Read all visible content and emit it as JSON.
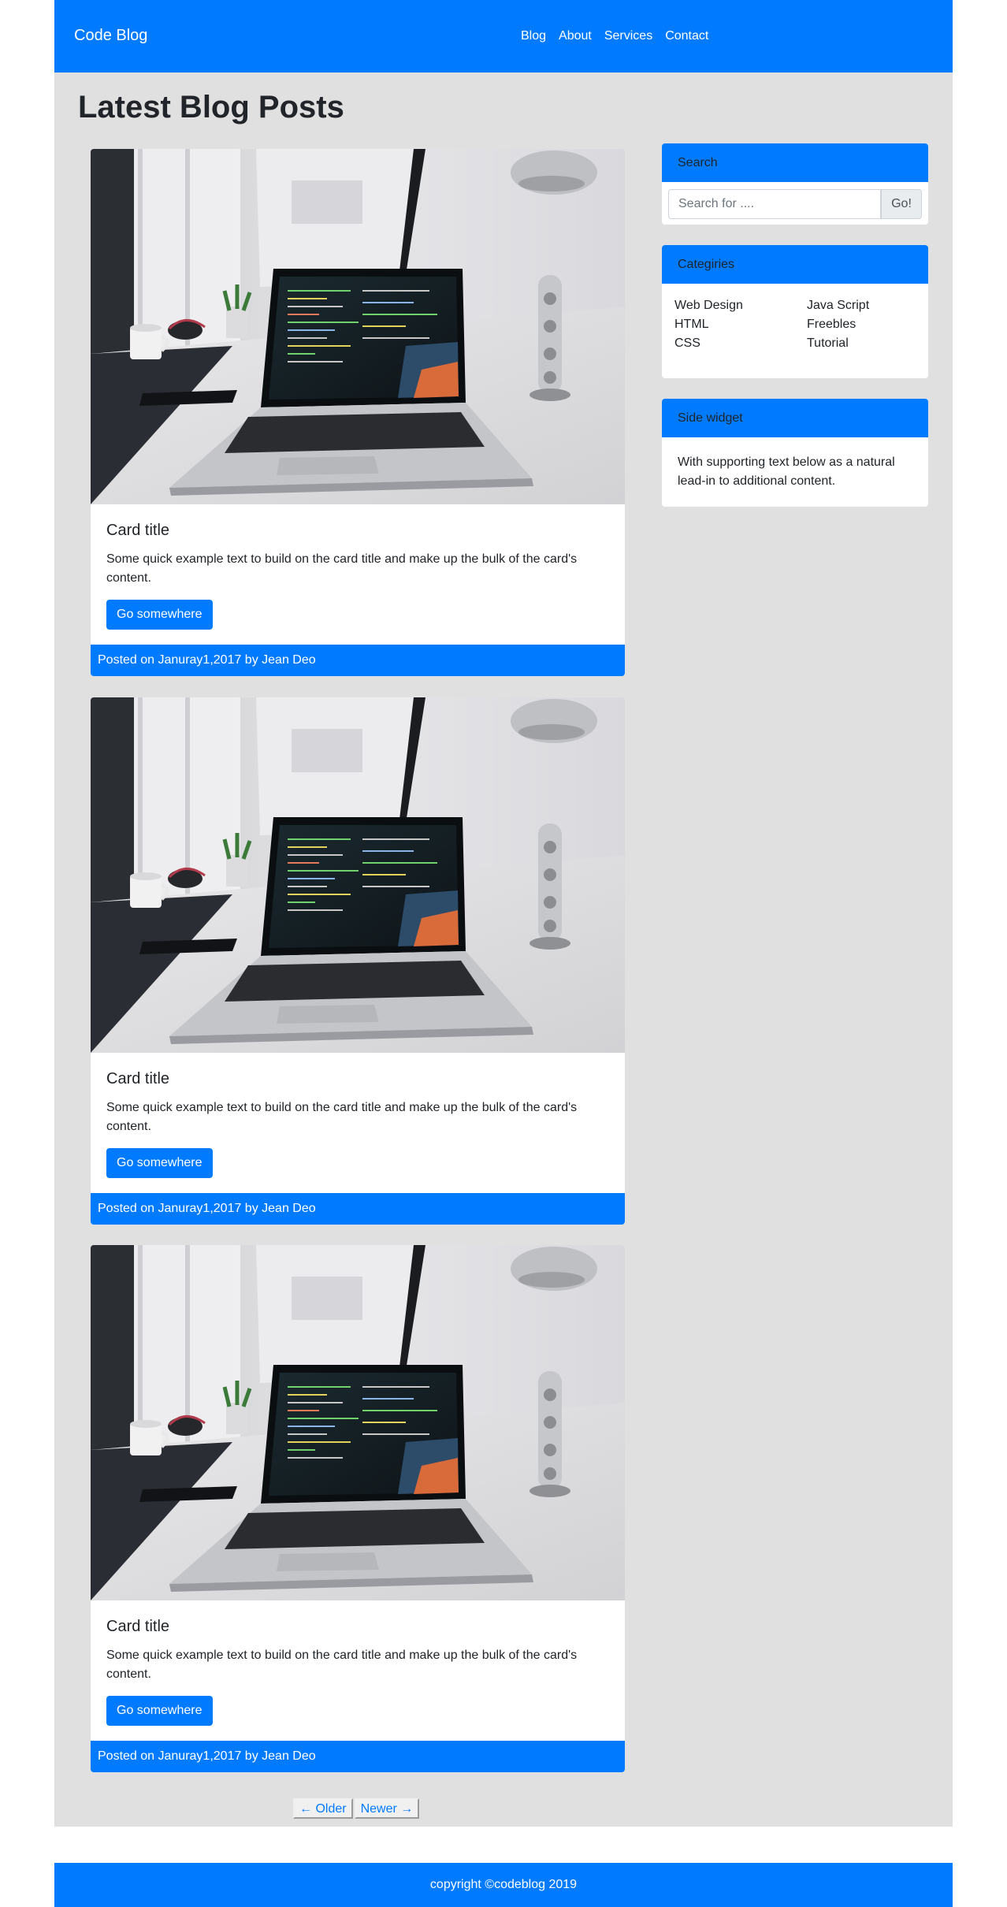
{
  "navbar": {
    "brand": "Code Blog",
    "links": [
      "Blog",
      "About",
      "Services",
      "Contact"
    ]
  },
  "page_title": "Latest Blog Posts",
  "posts": [
    {
      "title": "Card title",
      "text": "Some quick example text to build on the card title and make up the bulk of the card's content.",
      "button": "Go somewhere",
      "footer": "Posted on Januray1,2017 by Jean Deo"
    },
    {
      "title": "Card title",
      "text": "Some quick example text to build on the card title and make up the bulk of the card's content.",
      "button": "Go somewhere",
      "footer": "Posted on Januray1,2017 by Jean Deo"
    },
    {
      "title": "Card title",
      "text": "Some quick example text to build on the card title and make up the bulk of the card's content.",
      "button": "Go somewhere",
      "footer": "Posted on Januray1,2017 by Jean Deo"
    }
  ],
  "sidebar": {
    "search": {
      "title": "Search",
      "placeholder": "Search for ....",
      "button": "Go!"
    },
    "categories": {
      "title": "Categiries",
      "left": [
        "Web Design",
        "HTML",
        "CSS"
      ],
      "right": [
        "Java Script",
        "Freebles",
        "Tutorial"
      ]
    },
    "side_widget": {
      "title": "Side widget",
      "text": "With supporting text below as a natural lead-in to additional content."
    }
  },
  "pager": {
    "older": "← Older",
    "newer": "Newer →"
  },
  "footer": {
    "copyright": "copyright ©codeblog 2019"
  },
  "colors": {
    "primary": "#007bff",
    "page_bg": "#e0e0e0"
  }
}
